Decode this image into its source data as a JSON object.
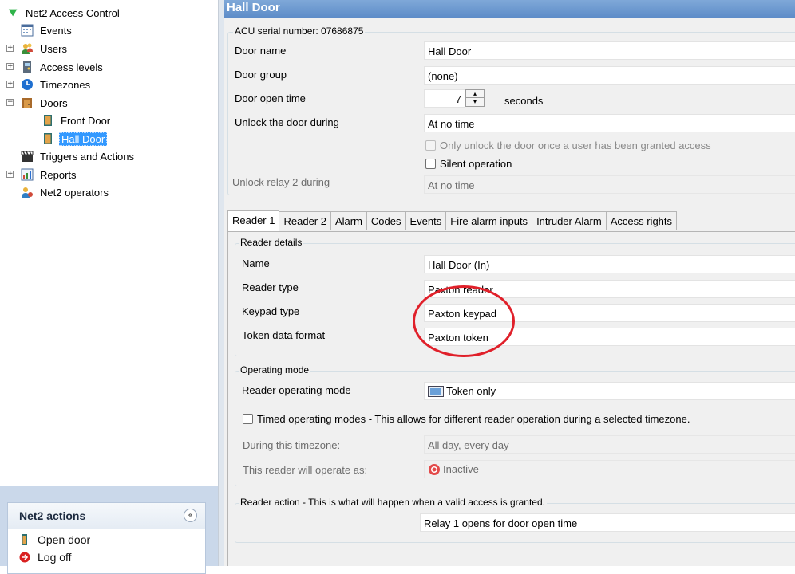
{
  "tree": {
    "root": "Net2 Access Control",
    "events": "Events",
    "users": "Users",
    "access_levels": "Access levels",
    "timezones": "Timezones",
    "doors": "Doors",
    "front_door": "Front Door",
    "hall_door": "Hall Door",
    "triggers": "Triggers and Actions",
    "reports": "Reports",
    "operators": "Net2 operators",
    "expand_glyph": "+",
    "collapse_glyph": "−"
  },
  "actions": {
    "title": "Net2 actions",
    "collapse_glyph": "«",
    "items": [
      "Open door",
      "Log off"
    ]
  },
  "door": {
    "title": "Hall Door",
    "acu_serial_label": "ACU serial number: 07686875",
    "name_label": "Door name",
    "name_value": "Hall Door",
    "group_label": "Door group",
    "group_value": "(none)",
    "open_time_label": "Door open time",
    "open_time_value": "7",
    "open_time_unit": "seconds",
    "unlock_label": "Unlock the door during",
    "unlock_value": "At no time",
    "only_unlock_granted": "Only unlock the door once a user has been granted access",
    "silent_operation": "Silent operation",
    "relay2_label": "Unlock relay 2 during",
    "relay2_value": "At no time"
  },
  "tabs": [
    "Reader 1",
    "Reader 2",
    "Alarm",
    "Codes",
    "Events",
    "Fire alarm inputs",
    "Intruder Alarm",
    "Access rights"
  ],
  "reader": {
    "details_group": "Reader details",
    "name_label": "Name",
    "name_value": "Hall Door (In)",
    "type_label": "Reader type",
    "type_value": "Paxton reader",
    "keypad_label": "Keypad type",
    "keypad_value": "Paxton keypad",
    "token_label": "Token data format",
    "token_value": "Paxton token",
    "mode_group": "Operating mode",
    "mode_label": "Reader operating mode",
    "mode_value": "Token only",
    "timed_modes": "Timed operating modes - This allows for different reader operation during a selected timezone.",
    "during_tz_label": "During this timezone:",
    "during_tz_value": "All day, every day",
    "operate_as_label": "This reader will operate as:",
    "operate_as_value": "Inactive",
    "action_group": "Reader action - This is what will happen when a valid access is granted.",
    "action_value": "Relay 1 opens for door open time"
  },
  "spin": {
    "up": "▴",
    "down": "▾"
  }
}
